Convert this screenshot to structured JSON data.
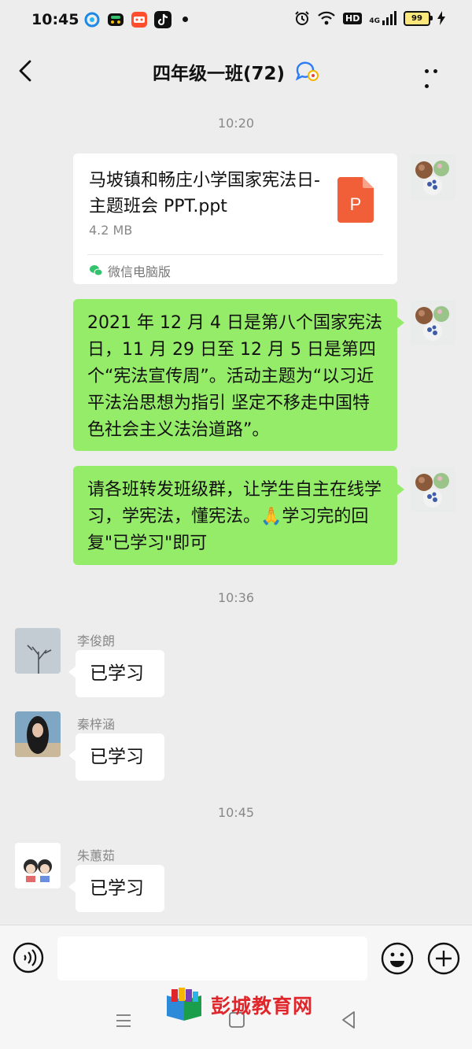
{
  "status_bar": {
    "time": "10:45",
    "net_hd": "HD",
    "net_type": "4G",
    "battery": "99",
    "left_app_icons": [
      "browser-icon",
      "video-app-icon",
      "shopping-app-icon",
      "tiktok-icon"
    ],
    "right_icons": [
      "alarm-icon",
      "wifi-icon",
      "hd-icon",
      "cellular-signal-icon",
      "battery-icon",
      "charging-icon"
    ]
  },
  "header": {
    "title": "四年级一班(72)",
    "back_icon": "chevron-left-icon",
    "group_icon": "group-chat-icon",
    "more_icon": "more-dots-icon"
  },
  "messages": [
    {
      "kind": "time",
      "text": "10:20"
    },
    {
      "kind": "file",
      "side": "right",
      "file_name": "马坡镇和畅庄小学国家宪法日-主题班会 PPT.ppt",
      "file_size": "4.2 MB",
      "file_type_letter": "P",
      "source": "微信电脑版",
      "source_icon": "wechat-pc-icon",
      "file_icon_color": "#f05f38"
    },
    {
      "kind": "text",
      "side": "right",
      "text": "2021 年 12 月 4 日是第八个国家宪法日，11 月 29 日至 12 月 5 日是第四个“宪法宣传周”。活动主题为“以习近平法治思想为指引 坚定不移走中国特色社会主义法治道路”。"
    },
    {
      "kind": "text",
      "side": "right",
      "text": "请各班转发班级群，让学生自主在线学习，学宪法，懂宪法。🙏学习完的回复\"已学习\"即可"
    },
    {
      "kind": "time",
      "text": "10:36"
    },
    {
      "kind": "text",
      "side": "left",
      "sender": "李俊朗",
      "text": "已学习"
    },
    {
      "kind": "text",
      "side": "left",
      "sender": "秦梓涵",
      "text": "已学习"
    },
    {
      "kind": "time",
      "text": "10:45"
    },
    {
      "kind": "text",
      "side": "left",
      "sender": "朱蕙茹",
      "text": "已学习"
    }
  ],
  "input_bar": {
    "voice_icon": "voice-icon",
    "emoji_icon": "emoji-icon",
    "plus_icon": "plus-icon",
    "input_value": ""
  },
  "nav_bar": {
    "icons": [
      "nav-menu-icon",
      "nav-home-icon",
      "nav-back-icon"
    ]
  },
  "watermark": {
    "text": "彭城教育网"
  },
  "colors": {
    "background": "#ededed",
    "my_bubble": "#95ec69",
    "other_bubble": "#ffffff",
    "watermark": "#e0262b"
  }
}
